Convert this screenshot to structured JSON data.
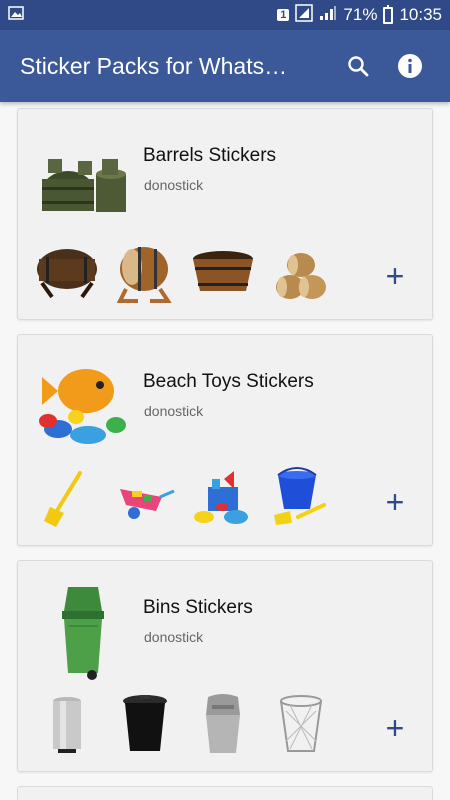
{
  "status_bar": {
    "battery_percent": "71%",
    "time": "10:35",
    "sim_label": "1"
  },
  "app_bar": {
    "title": "Sticker Packs for Whats…",
    "search_icon": "search-icon",
    "info_icon": "info-icon"
  },
  "packs": [
    {
      "name": "Barrels Stickers",
      "author": "donostick",
      "tray_icon": "barrels-tray-icon",
      "stickers": [
        "wooden-barrel-on-stand",
        "oak-barrel-on-rack",
        "wooden-tub",
        "stacked-barrels"
      ]
    },
    {
      "name": "Beach Toys Stickers",
      "author": "donostick",
      "tray_icon": "beach-toys-tray-icon",
      "stickers": [
        "yellow-shovel",
        "toy-wheelbarrow",
        "sand-castle-set",
        "blue-bucket-and-shovel"
      ]
    },
    {
      "name": "Bins Stickers",
      "author": "donostick",
      "tray_icon": "bins-tray-icon",
      "stickers": [
        "steel-pedal-bin",
        "black-dustbin",
        "grey-swing-bin",
        "wire-mesh-bin"
      ]
    }
  ],
  "add_label": "+"
}
